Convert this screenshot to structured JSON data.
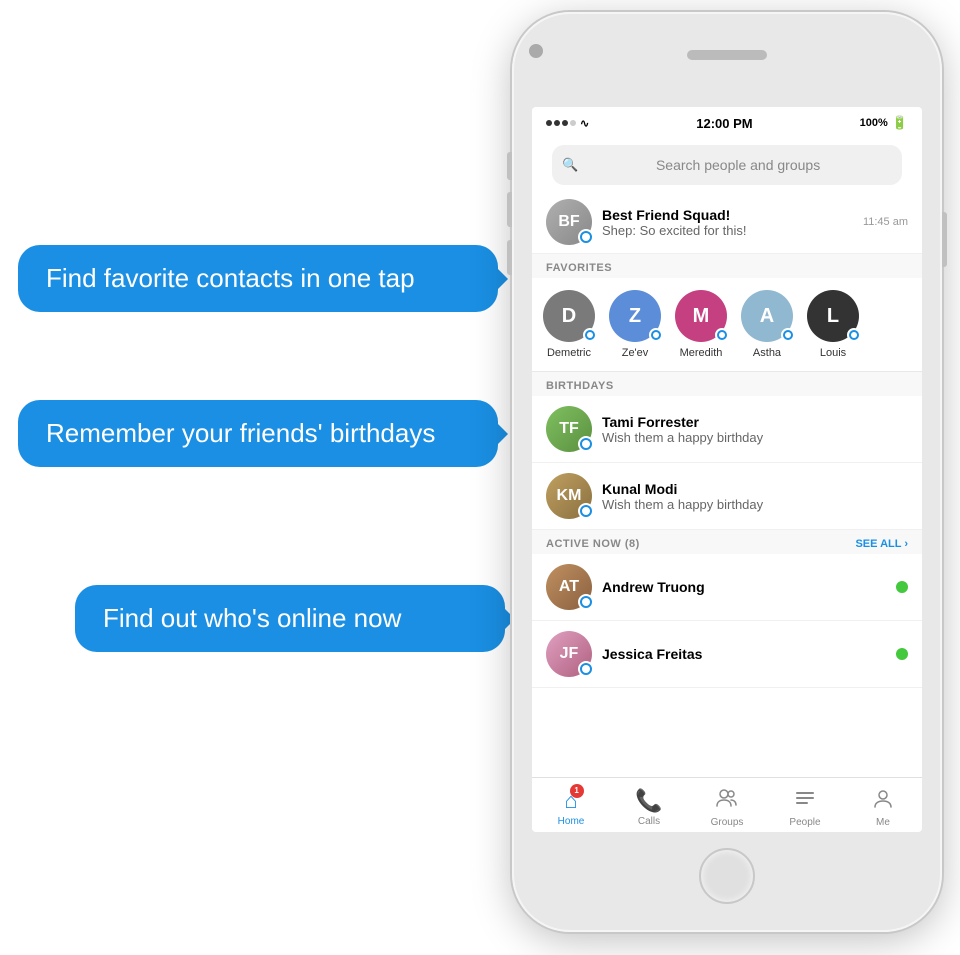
{
  "callouts": {
    "c1": "Find favorite contacts in one tap",
    "c2": "Remember your friends' birthdays",
    "c3": "Find out who's online now"
  },
  "phone": {
    "status": {
      "time": "12:00 PM",
      "battery": "100%",
      "signal": "●●●○○",
      "wifi": "WiFi"
    },
    "search_placeholder": "Search people and groups",
    "edit_icon": "✏",
    "message_preview": {
      "name": "Best Friend Squad!",
      "preview": "Shep: So excited for this!",
      "time": "11:45 am"
    },
    "sections": {
      "favorites_label": "FAVORITES",
      "birthdays_label": "BIRTHDAYS",
      "active_label": "ACTIVE NOW (8)",
      "see_all": "SEE ALL ›"
    },
    "favorites": [
      {
        "name": "Demetric",
        "color": "#7a7a7a",
        "initials": "D"
      },
      {
        "name": "Ze'ev",
        "color": "#5b8dd9",
        "initials": "Z"
      },
      {
        "name": "Meredith",
        "color": "#c44080",
        "initials": "M"
      },
      {
        "name": "Astha",
        "color": "#90b8d0",
        "initials": "A"
      },
      {
        "name": "Louis",
        "color": "#333",
        "initials": "L"
      }
    ],
    "birthdays": [
      {
        "name": "Tami Forrester",
        "sub": "Wish them a happy birthday"
      },
      {
        "name": "Kunal Modi",
        "sub": "Wish them a happy birthday"
      }
    ],
    "active": [
      {
        "name": "Andrew Truong"
      },
      {
        "name": "Jessica Freitas"
      }
    ],
    "nav": [
      {
        "label": "Home",
        "icon": "⌂",
        "active": true,
        "badge": "1"
      },
      {
        "label": "Calls",
        "icon": "📞",
        "active": false,
        "badge": ""
      },
      {
        "label": "Groups",
        "icon": "👥",
        "active": false,
        "badge": ""
      },
      {
        "label": "People",
        "icon": "☰",
        "active": false,
        "badge": ""
      },
      {
        "label": "Me",
        "icon": "◯",
        "active": false,
        "badge": ""
      }
    ]
  }
}
